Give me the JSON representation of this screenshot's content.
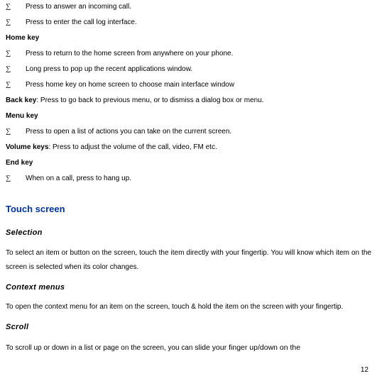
{
  "bullets1": [
    "Press to answer an incoming call.",
    "Press to enter the call log interface."
  ],
  "home_key_label": "Home key",
  "bullets_home": [
    "Press to return to the home screen from anywhere on your phone.",
    "Long press to pop up the recent applications window.",
    "Press home key on home screen to choose main interface window"
  ],
  "back_key_label": "Back key",
  "back_key_text": ": Press to go back to previous menu, or to dismiss a dialog box or menu.",
  "menu_key_label": "Menu key",
  "bullets_menu": [
    "Press to open a list of actions you can take on the current screen."
  ],
  "volume_keys_label": "Volume keys",
  "volume_keys_text": ": Press to adjust the volume of the call, video, FM etc.",
  "end_key_label": "End key",
  "bullets_end": [
    "When on a call, press to hang up."
  ],
  "touch_screen_title": "Touch screen",
  "selection_head": "Selection",
  "selection_body": "To select an item or button on the screen, touch the item directly with your fingertip. You will know which item on the screen is selected when its color changes.",
  "context_head": "Context menus",
  "context_body": "To open the context menu for an item on the screen, touch & hold the item on the screen with your fingertip.",
  "scroll_head": "Scroll",
  "scroll_body_a": "To scroll up or down in a list or page on the screen, you can ",
  "scroll_body_b": "slide your finger up/down on the",
  "page_number": "12"
}
